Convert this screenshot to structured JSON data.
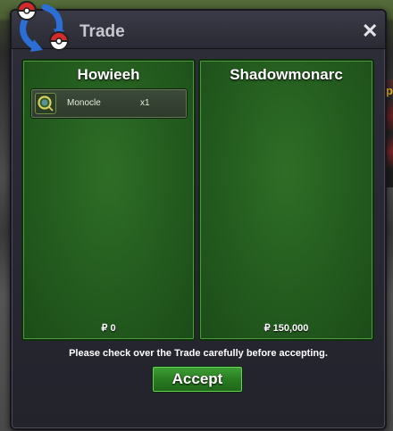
{
  "window": {
    "title": "Trade",
    "close_label": "✕"
  },
  "left_panel": {
    "player_name": "Howieeh",
    "items": [
      {
        "name": "Monocle",
        "quantity": "x1",
        "icon": "monocle-icon"
      }
    ],
    "money": "₽ 0"
  },
  "right_panel": {
    "player_name": "Shadowmonarc",
    "items": [],
    "money": "₽ 150,000"
  },
  "footer": {
    "message": "Please check over the Trade carefully before accepting.",
    "accept_label": "Accept"
  },
  "background": {
    "partial_text": "yp"
  },
  "colors": {
    "panel_green": "#235b1e",
    "window_bg": "#2a2a34",
    "accept_green": "#2a7c22",
    "currency_text": "#ffffff"
  }
}
